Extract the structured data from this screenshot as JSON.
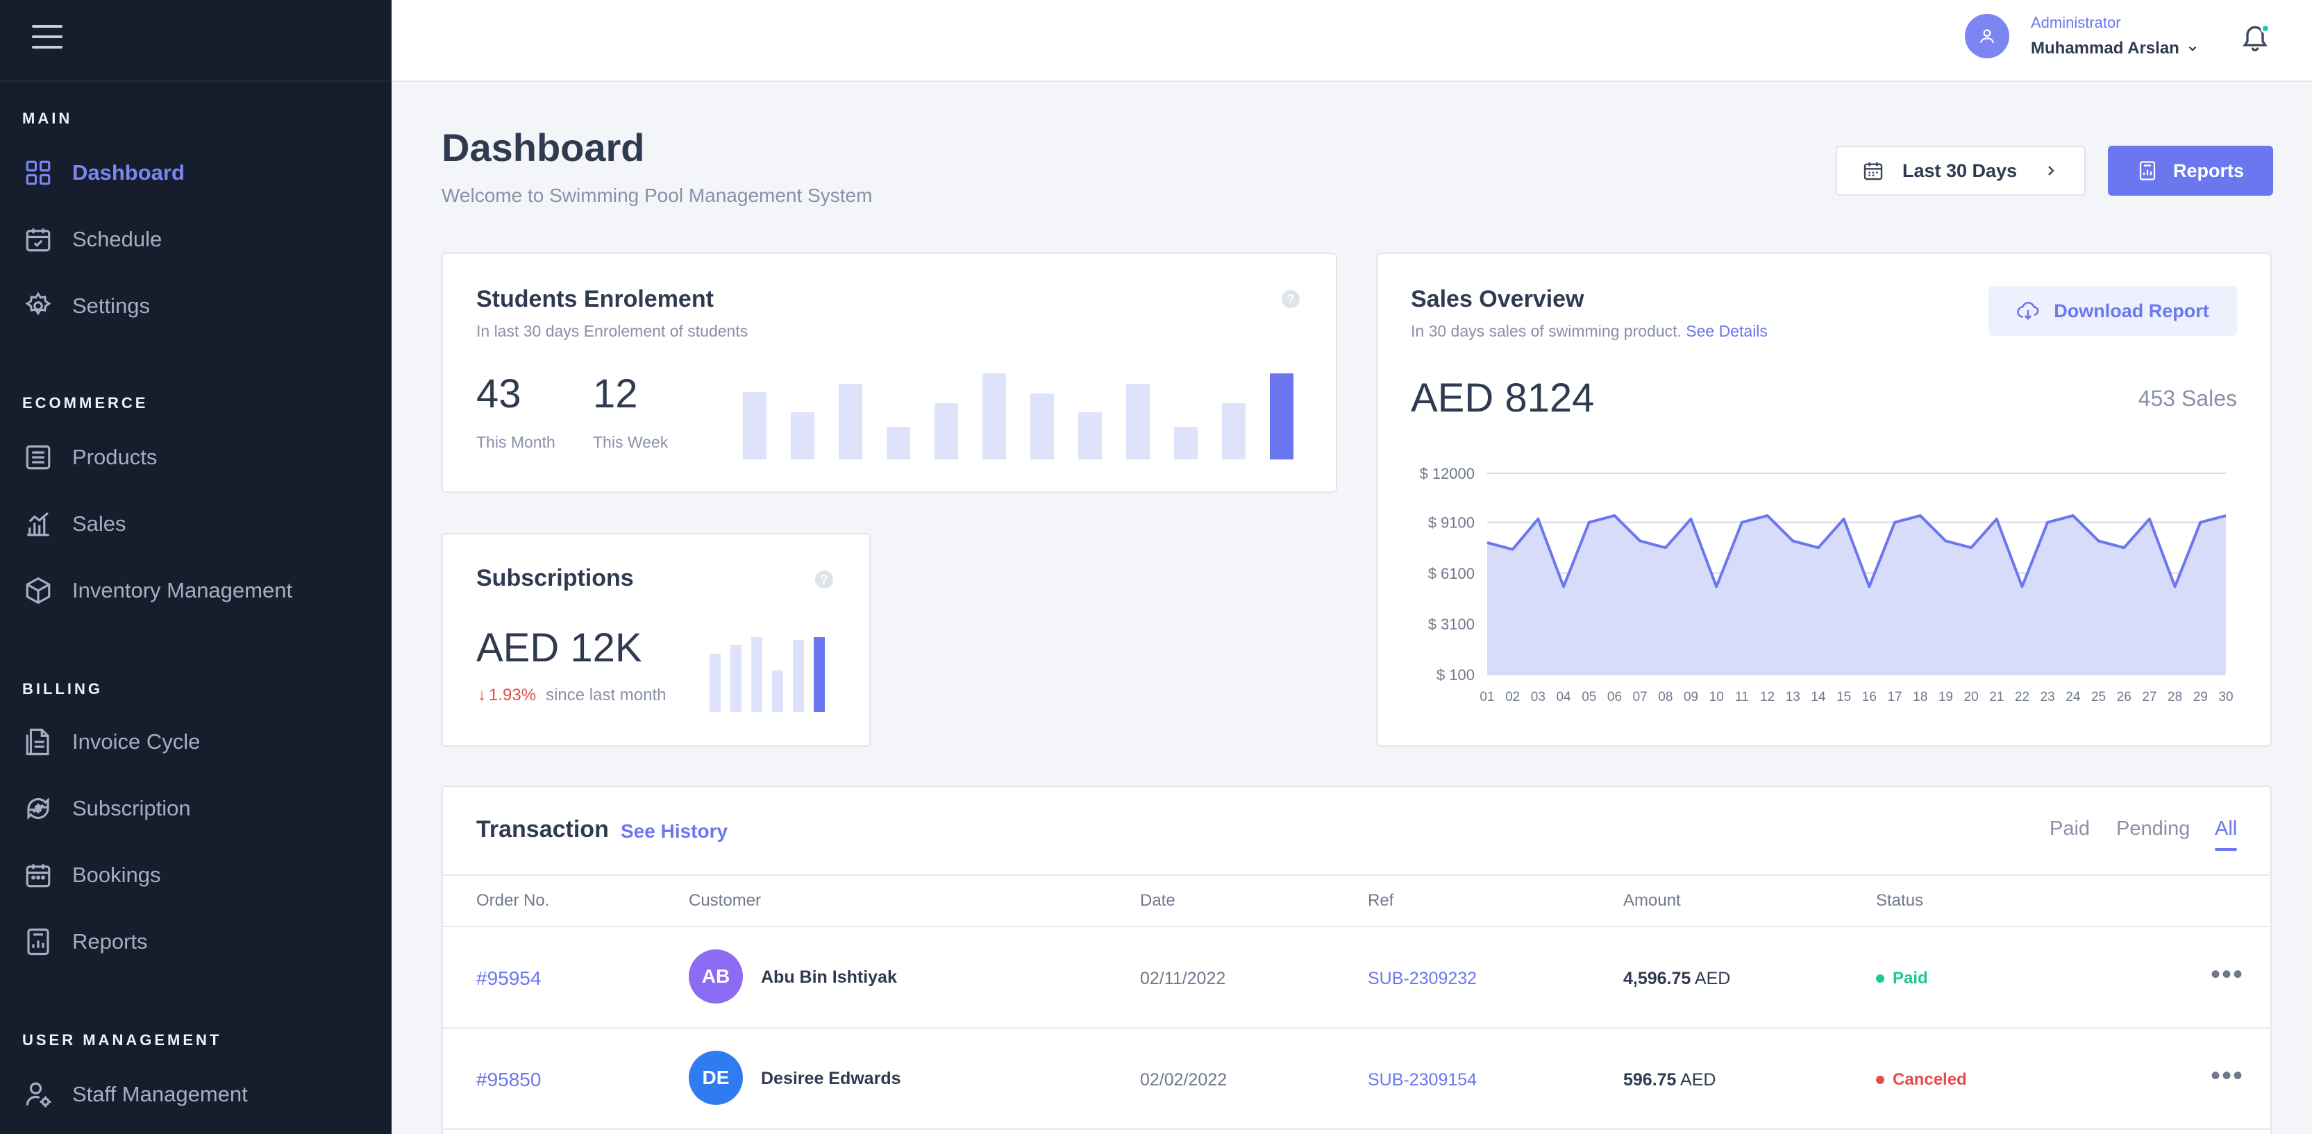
{
  "sidebar": {
    "sections": [
      {
        "title": "MAIN"
      },
      {
        "title": "ECOMMERCE"
      },
      {
        "title": "BILLING"
      },
      {
        "title": "USER MANAGEMENT"
      }
    ],
    "items": [
      {
        "label": "Dashboard",
        "icon": "grid-icon"
      },
      {
        "label": "Schedule",
        "icon": "calendar-check-icon"
      },
      {
        "label": "Settings",
        "icon": "gear-icon"
      },
      {
        "label": "Products",
        "icon": "list-box-icon"
      },
      {
        "label": "Sales",
        "icon": "bar-chart-icon"
      },
      {
        "label": "Inventory Management",
        "icon": "box-icon"
      },
      {
        "label": "Invoice Cycle",
        "icon": "document-icon"
      },
      {
        "label": "Subscription",
        "icon": "refresh-dollar-icon"
      },
      {
        "label": "Bookings",
        "icon": "calendar-icon"
      },
      {
        "label": "Reports",
        "icon": "report-icon"
      },
      {
        "label": "Staff Management",
        "icon": "user-gear-icon"
      }
    ]
  },
  "topbar": {
    "role": "Administrator",
    "user_name": "Muhammad Arslan"
  },
  "header": {
    "title": "Dashboard",
    "subtitle": "Welcome to Swimming Pool Management System",
    "range_label": "Last 30 Days",
    "reports_label": "Reports"
  },
  "enrolment": {
    "title": "Students Enrolement",
    "subtitle": "In last 30 days Enrolement of students",
    "month_value": "43",
    "month_label": "This Month",
    "week_value": "12",
    "week_label": "This Week",
    "bars": [
      0.78,
      0.55,
      0.88,
      0.38,
      0.65,
      1.0,
      0.77,
      0.55,
      0.88,
      0.38,
      0.65,
      1.0
    ]
  },
  "subscriptions": {
    "title": "Subscriptions",
    "value": "AED 12K",
    "change": "1.93%",
    "change_note": "since last month",
    "bars": [
      0.78,
      0.9,
      1.0,
      0.56,
      0.96,
      1.0
    ]
  },
  "sales": {
    "title": "Sales Overview",
    "subtitle": "In 30 days sales of swimming product.",
    "link": "See Details",
    "download_label": "Download Report",
    "total": "AED 8124",
    "count": "453 Sales"
  },
  "chart_data": {
    "type": "area",
    "x": [
      "01",
      "02",
      "03",
      "04",
      "05",
      "06",
      "07",
      "08",
      "09",
      "10",
      "11",
      "12",
      "13",
      "14",
      "15",
      "16",
      "17",
      "18",
      "19",
      "20",
      "21",
      "22",
      "23",
      "24",
      "25",
      "26",
      "27",
      "28",
      "29",
      "30"
    ],
    "y_ticks": [
      "$ 12000",
      "$ 9100",
      "$ 6100",
      "$ 3100",
      "$ 100"
    ],
    "ylim": [
      100,
      12000
    ],
    "series": [
      {
        "values": [
          7900,
          7500,
          9300,
          5300,
          9100,
          9500,
          8000,
          7600,
          9300,
          5300,
          9100,
          9500,
          8000,
          7600,
          9300,
          5300,
          9100,
          9500,
          8000,
          7600,
          9300,
          5300,
          9100,
          9500,
          8000,
          7600,
          9300,
          5300,
          9100,
          9500
        ]
      }
    ],
    "color": "#6b77ee",
    "fill": "#d8dcfb",
    "grid": true
  },
  "transactions": {
    "title": "Transaction",
    "history_link": "See History",
    "tabs": [
      "Paid",
      "Pending",
      "All"
    ],
    "columns": [
      "Order No.",
      "Customer",
      "Date",
      "Ref",
      "Amount",
      "Status"
    ],
    "rows": [
      {
        "order": "#95954",
        "initials": "AB",
        "avatar_color": "#8b6cf3",
        "customer": "Abu Bin Ishtiyak",
        "date": "02/11/2022",
        "ref": "SUB-2309232",
        "amount": "4,596.75",
        "currency": "AED",
        "status": "Paid",
        "status_color": "#1ec98c"
      },
      {
        "order": "#95850",
        "initials": "DE",
        "avatar_color": "#2e7cf0",
        "customer": "Desiree Edwards",
        "date": "02/02/2022",
        "ref": "SUB-2309154",
        "amount": "596.75",
        "currency": "AED",
        "status": "Canceled",
        "status_color": "#e84a4a"
      }
    ]
  }
}
